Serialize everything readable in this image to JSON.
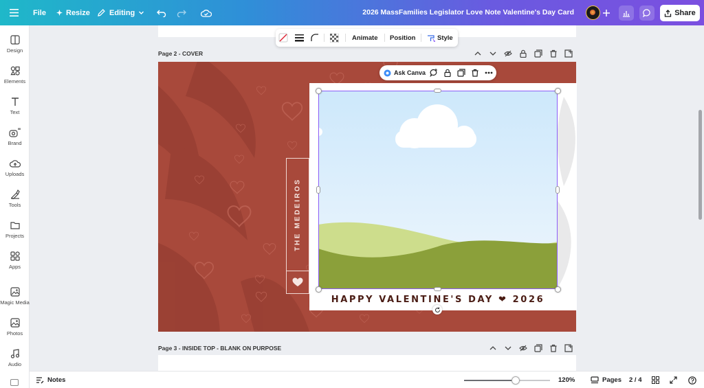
{
  "topbar": {
    "file_label": "File",
    "resize_label": "Resize",
    "editing_label": "Editing",
    "doc_title": "2026 MassFamilies Legislator Love Note Valentine's Day Card",
    "share_label": "Share"
  },
  "sidebar": {
    "items": [
      {
        "label": "Design",
        "icon": "design-icon"
      },
      {
        "label": "Elements",
        "icon": "elements-icon"
      },
      {
        "label": "Text",
        "icon": "text-icon"
      },
      {
        "label": "Brand",
        "icon": "brand-icon"
      },
      {
        "label": "Uploads",
        "icon": "uploads-icon"
      },
      {
        "label": "Tools",
        "icon": "tools-icon"
      },
      {
        "label": "Projects",
        "icon": "projects-icon"
      },
      {
        "label": "Apps",
        "icon": "apps-icon"
      },
      {
        "label": "Magic Media",
        "icon": "magic-media-icon"
      },
      {
        "label": "Photos",
        "icon": "photos-icon"
      },
      {
        "label": "Audio",
        "icon": "audio-icon"
      }
    ]
  },
  "toolbar": {
    "animate_label": "Animate",
    "position_label": "Position",
    "style_label": "Style"
  },
  "pages": {
    "page2_label": "Page 2 - COVER",
    "page3_label": "Page 3 - INSIDE TOP - BLANK ON PURPOSE"
  },
  "ask": {
    "label": "Ask Canva"
  },
  "card": {
    "name_text": "THE MEDEIROS",
    "valentine_text": "HAPPY VALENTINE'S DAY ❤ 2026",
    "bg_color": "#a8493b"
  },
  "bottombar": {
    "notes_label": "Notes",
    "zoom_value": 0.6,
    "zoom_label": "120%",
    "pages_label": "Pages",
    "page_counter": "2 / 4"
  }
}
